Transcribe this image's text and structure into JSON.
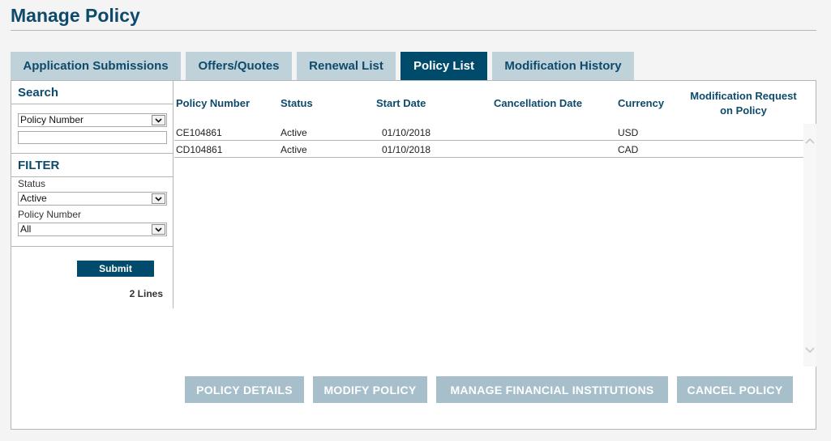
{
  "header": {
    "title": "Manage Policy"
  },
  "tabs": [
    {
      "label": "Application Submissions",
      "active": false
    },
    {
      "label": "Offers/Quotes",
      "active": false
    },
    {
      "label": "Renewal List",
      "active": false
    },
    {
      "label": "Policy List",
      "active": true
    },
    {
      "label": "Modification History",
      "active": false
    }
  ],
  "sidebar": {
    "search_heading": "Search",
    "search_by": "Policy Number",
    "search_value": "",
    "filter_heading": "FILTER",
    "status_label": "Status",
    "status_value": "Active",
    "policy_number_label": "Policy Number",
    "policy_number_value": "All",
    "submit_label": "Submit",
    "line_count": "2 Lines"
  },
  "table": {
    "columns": [
      "Policy Number",
      "Status",
      "Start Date",
      "Cancellation Date",
      "Currency",
      "Modification Request on Policy"
    ],
    "rows": [
      {
        "policy_number": "CE104861",
        "status": "Active",
        "start_date": "01/10/2018",
        "cancellation_date": "",
        "currency": "USD",
        "modification_request": ""
      },
      {
        "policy_number": "CD104861",
        "status": "Active",
        "start_date": "01/10/2018",
        "cancellation_date": "",
        "currency": "CAD",
        "modification_request": ""
      }
    ]
  },
  "actions": {
    "policy_details": "POLICY DETAILS",
    "modify_policy": "MODIFY POLICY",
    "manage_financial_institutions": "MANAGE FINANCIAL INSTITUTIONS",
    "cancel_policy": "CANCEL POLICY"
  },
  "icons": {
    "dropdown": "chevron-down-icon",
    "scroll_up": "chevron-up-icon",
    "scroll_down": "chevron-down-icon"
  },
  "colors": {
    "brand": "#004b6b",
    "heading_text": "#0d4a6b",
    "tab_inactive": "#bfd2da",
    "action_button": "#a7bfca"
  }
}
